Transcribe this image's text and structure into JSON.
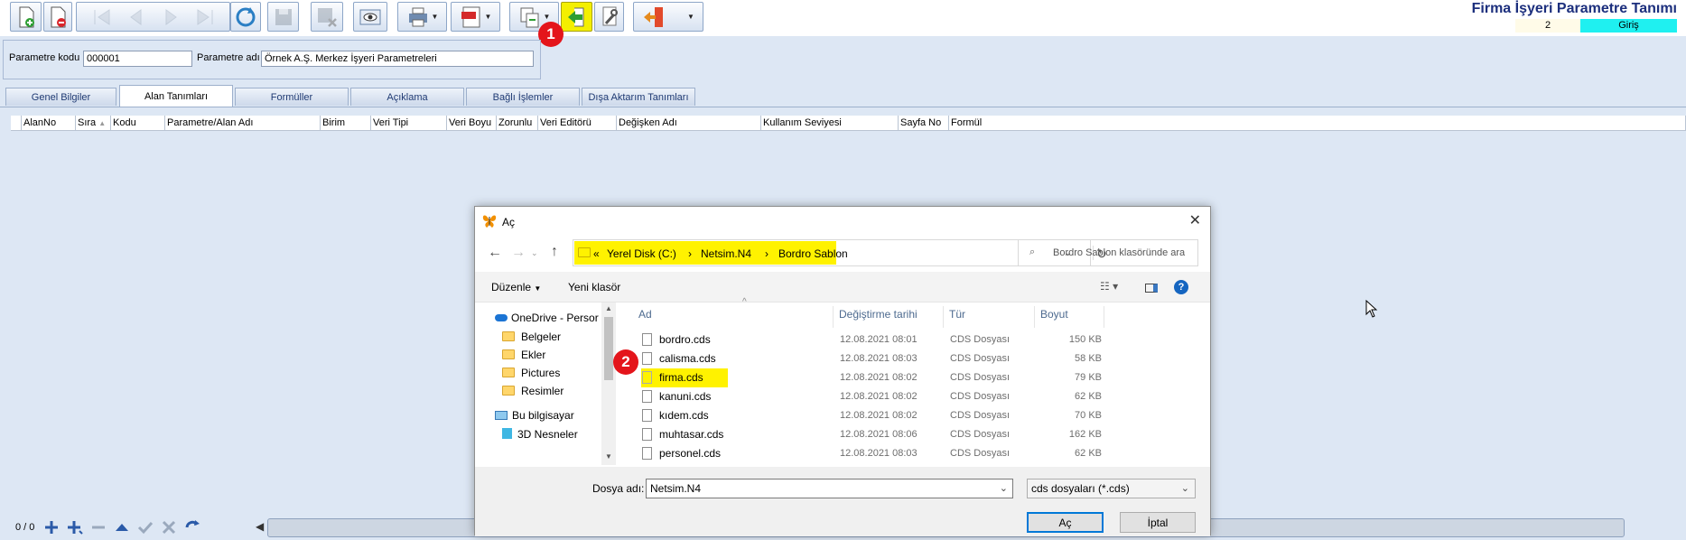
{
  "app": {
    "title": "Firma İşyeri Parametre Tanımı",
    "mode_count": "2",
    "mode": "Giriş"
  },
  "parameter": {
    "code_label": "Parametre kodu",
    "code_value": "000001",
    "name_label": "Parametre adı",
    "name_value": "Örnek A.Ş. Merkez İşyeri Parametreleri"
  },
  "tabs": [
    "Genel Bilgiler",
    "Alan Tanımları",
    "Formüller",
    "Açıklama",
    "Bağlı İşlemler",
    "Dışa Aktarım Tanımları"
  ],
  "grid_columns": [
    "AlanNo",
    "Sıra",
    "Kodu",
    "Parametre/Alan Adı",
    "Birim",
    "Veri Tipi",
    "Veri Boyu",
    "Zorunlu",
    "Veri Editörü",
    "Değişken Adı",
    "Kullanım Seviyesi",
    "Sayfa No",
    "Formül"
  ],
  "badges": [
    "1",
    "2"
  ],
  "record_count": "0 / 0",
  "dialog": {
    "title": "Aç",
    "breadcrumb": [
      "Yerel Disk (C:)",
      "Netsim.N4",
      "Bordro Sablon"
    ],
    "breadcrumb_prefix": "«",
    "search_placeholder": "Bordro Sablon klasöründe ara",
    "toolbar": {
      "organize": "Düzenle",
      "new_folder": "Yeni klasör"
    },
    "nav_items": [
      "OneDrive - Persor",
      "Belgeler",
      "Ekler",
      "Pictures",
      "Resimler",
      "Bu bilgisayar",
      "3D Nesneler"
    ],
    "columns": [
      "Ad",
      "Değiştirme tarihi",
      "Tür",
      "Boyut"
    ],
    "files": [
      {
        "name": "bordro.cds",
        "date": "12.08.2021 08:01",
        "type": "CDS Dosyası",
        "size": "150 KB"
      },
      {
        "name": "calisma.cds",
        "date": "12.08.2021 08:03",
        "type": "CDS Dosyası",
        "size": "58 KB"
      },
      {
        "name": "firma.cds",
        "date": "12.08.2021 08:02",
        "type": "CDS Dosyası",
        "size": "79 KB"
      },
      {
        "name": "kanuni.cds",
        "date": "12.08.2021 08:02",
        "type": "CDS Dosyası",
        "size": "62 KB"
      },
      {
        "name": "kıdem.cds",
        "date": "12.08.2021 08:02",
        "type": "CDS Dosyası",
        "size": "70 KB"
      },
      {
        "name": "muhtasar.cds",
        "date": "12.08.2021 08:06",
        "type": "CDS Dosyası",
        "size": "162 KB"
      },
      {
        "name": "personel.cds",
        "date": "12.08.2021 08:03",
        "type": "CDS Dosyası",
        "size": "62 KB"
      }
    ],
    "filename_label": "Dosya adı:",
    "filename_value": "Netsim.N4",
    "filetype_value": "cds dosyaları (*.cds)",
    "open_button": "Aç",
    "cancel_button": "İptal"
  },
  "colors": {
    "highlight": "#fff200",
    "title": "#1c2f7d",
    "mode_bg": "#1ff0f0",
    "badge": "#e4151b"
  }
}
